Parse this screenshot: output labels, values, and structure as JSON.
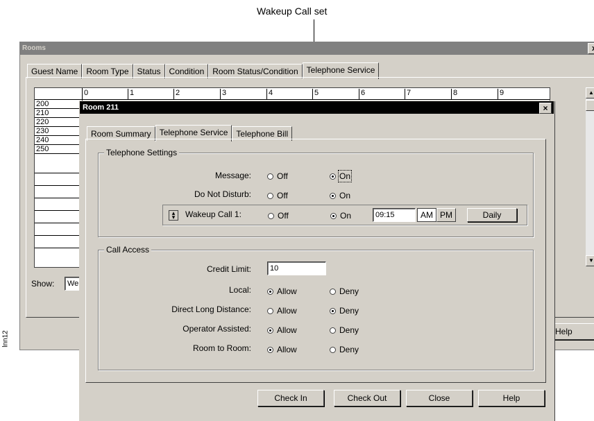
{
  "annotation": {
    "callout": "Wakeup Call set",
    "figure_id": "lnn12"
  },
  "rooms_window": {
    "title": "Rooms",
    "close_glyph": "x",
    "tabs": [
      "Guest Name",
      "Room Type",
      "Status",
      "Condition",
      "Room Status/Condition",
      "Telephone Service"
    ],
    "grid": {
      "hour_headers": [
        "0",
        "1",
        "2",
        "3",
        "4",
        "5",
        "6",
        "7",
        "8",
        "9"
      ],
      "rooms": [
        "200",
        "210",
        "220",
        "230",
        "240",
        "250",
        "",
        "",
        "",
        "",
        "",
        "",
        ""
      ]
    },
    "show_label": "Show:",
    "show_value": "We",
    "help_button": "Help"
  },
  "dialog": {
    "title": "Room 211",
    "close_glyph": "×",
    "tabs": [
      "Room Summary",
      "Telephone Service",
      "Telephone Bill"
    ],
    "telephone_settings": {
      "group_title": "Telephone Settings",
      "rows": [
        {
          "label": "Message:",
          "off": "Off",
          "on": "On",
          "selected": "on"
        },
        {
          "label": "Do Not Disturb:",
          "off": "Off",
          "on": "On",
          "selected": "on"
        },
        {
          "label": "Wakeup Call 1:",
          "off": "Off",
          "on": "On",
          "selected": "on"
        }
      ],
      "wakeup_time": "09:15",
      "am_label": "AM",
      "pm_label": "PM",
      "frequency": "Daily"
    },
    "call_access": {
      "group_title": "Call Access",
      "credit_limit_label": "Credit Limit:",
      "credit_limit_value": "10",
      "rows": [
        {
          "label": "Local:",
          "allow": "Allow",
          "deny": "Deny",
          "selected": "allow"
        },
        {
          "label": "Direct Long Distance:",
          "allow": "Allow",
          "deny": "Deny",
          "selected": "deny"
        },
        {
          "label": "Operator Assisted:",
          "allow": "Allow",
          "deny": "Deny",
          "selected": "allow"
        },
        {
          "label": "Room to Room:",
          "allow": "Allow",
          "deny": "Deny",
          "selected": "allow"
        }
      ]
    },
    "buttons": {
      "check_in": "Check In",
      "check_out": "Check Out",
      "close": "Close",
      "help": "Help"
    }
  }
}
